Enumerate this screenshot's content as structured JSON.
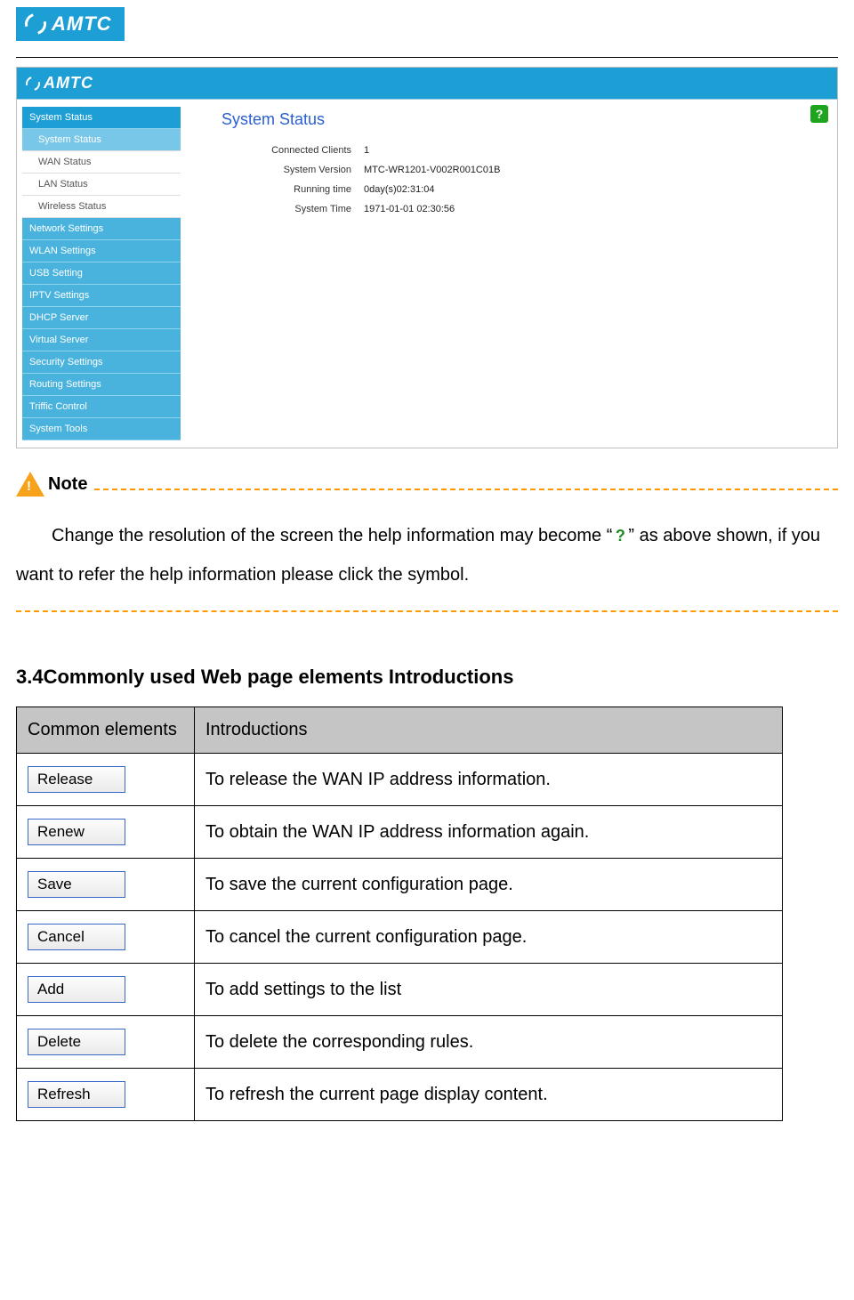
{
  "brand": "AMTC",
  "screenshot": {
    "brand": "AMTC",
    "help_symbol": "?",
    "title": "System Status",
    "sidebar": {
      "groups": [
        {
          "label": "System Status",
          "subs": [
            "System Status",
            "WAN Status",
            "LAN Status",
            "Wireless Status"
          ],
          "active_sub": 0
        },
        {
          "label": "Network Settings"
        },
        {
          "label": "WLAN Settings"
        },
        {
          "label": "USB Setting"
        },
        {
          "label": "IPTV Settings"
        },
        {
          "label": "DHCP Server"
        },
        {
          "label": "Virtual Server"
        },
        {
          "label": "Security Settings"
        },
        {
          "label": "Routing Settings"
        },
        {
          "label": "Triffic Control"
        },
        {
          "label": "System Tools"
        }
      ]
    },
    "rows": [
      {
        "k": "Connected Clients",
        "v": "1"
      },
      {
        "k": "System Version",
        "v": "MTC-WR1201-V002R001C01B"
      },
      {
        "k": "Running time",
        "v": "0day(s)02:31:04"
      },
      {
        "k": "System Time",
        "v": "1971-01-01 02:30:56"
      }
    ]
  },
  "note": {
    "label": "Note",
    "text_pre": "Change the resolution of the screen the help information may become “",
    "q": "?",
    "text_post": "” as above shown, if you want to refer the help information please click the symbol."
  },
  "section_heading": "3.4Commonly used Web page elements Introductions",
  "table": {
    "headers": [
      "Common elements",
      "Introductions"
    ],
    "rows": [
      {
        "btn": "Release",
        "desc": "To release the WAN IP address information."
      },
      {
        "btn": "Renew",
        "desc": "To obtain the WAN IP address information again."
      },
      {
        "btn": "Save",
        "desc": "To save the current configuration page."
      },
      {
        "btn": "Cancel",
        "desc": "To cancel the current configuration page."
      },
      {
        "btn": "Add",
        "desc": "To add settings to the list"
      },
      {
        "btn": "Delete",
        "desc": "To delete the corresponding rules."
      },
      {
        "btn": "Refresh",
        "desc": "To refresh the current page display content."
      }
    ]
  }
}
